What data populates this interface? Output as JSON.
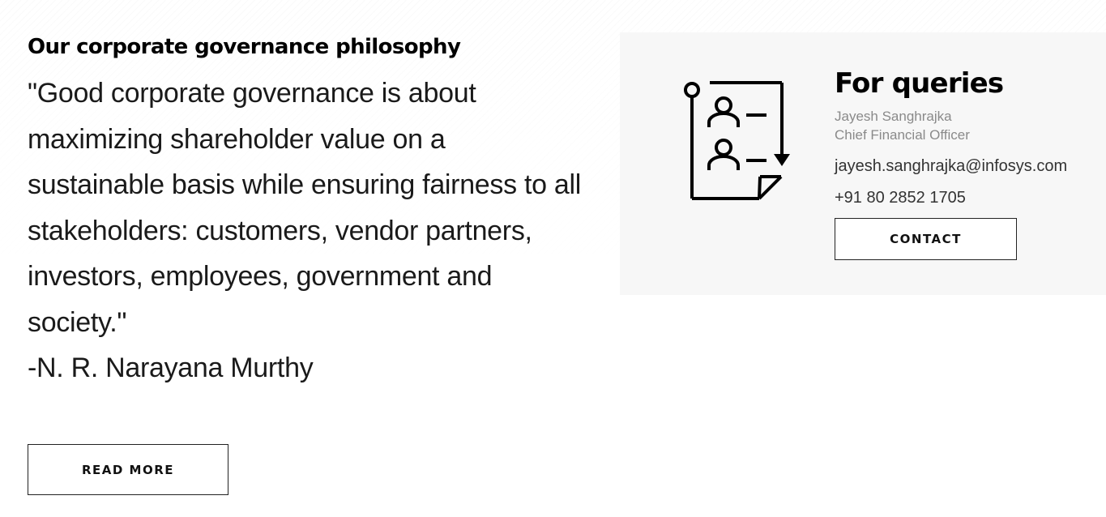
{
  "governance": {
    "heading": "Our corporate governance philosophy",
    "quote": "\"Good corporate governance is about maximizing shareholder value on a sustainable basis while ensuring fairness to all stakeholders: customers, vendor partners, investors, employees, government and society.\"",
    "author": "-N. R. Narayana Murthy",
    "read_more_label": "READ MORE"
  },
  "queries": {
    "title": "For queries",
    "icon": "contact-list-icon",
    "name": "Jayesh Sanghrajka",
    "role": "Chief Financial Officer",
    "email": "jayesh.sanghrajka@infosys.com",
    "phone": "+91 80 2852 1705",
    "contact_label": "CONTACT"
  },
  "colors": {
    "card_background": "#f7f7f7",
    "text": "#1a1a1a",
    "muted_text": "#8a8a8a",
    "border": "#222222"
  }
}
